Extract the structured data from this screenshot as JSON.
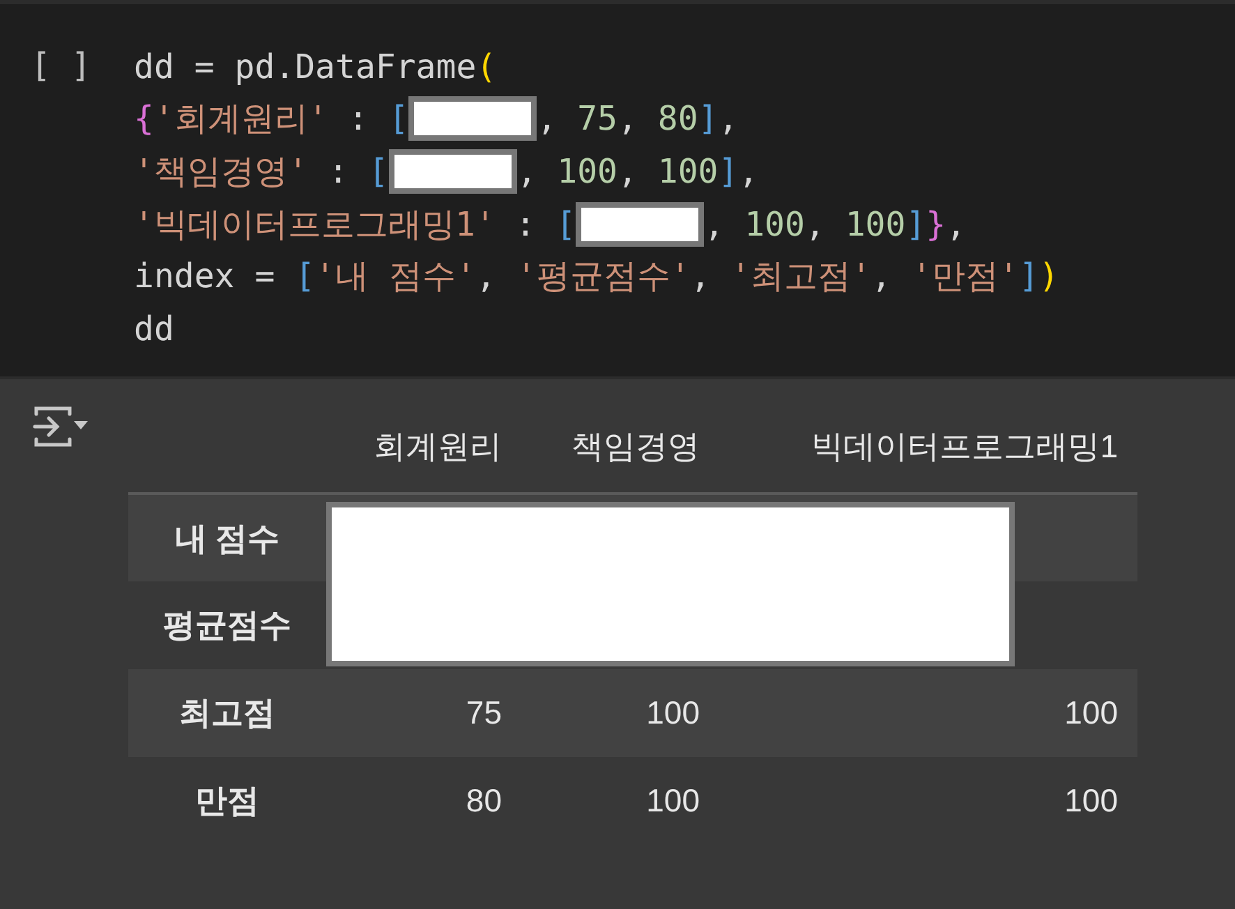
{
  "code_cell": {
    "run_marker": "[ ]",
    "lines": [
      [
        {
          "kind": "plain",
          "text": "dd = pd.DataFrame"
        },
        {
          "kind": "paren",
          "text": "("
        }
      ],
      [
        {
          "kind": "brace",
          "text": "{"
        },
        {
          "kind": "string",
          "text": "'회계원리'"
        },
        {
          "kind": "plain",
          "text": " : "
        },
        {
          "kind": "bracket",
          "text": "["
        },
        {
          "kind": "redacted"
        },
        {
          "kind": "plain",
          "text": ", "
        },
        {
          "kind": "number",
          "text": "75"
        },
        {
          "kind": "plain",
          "text": ", "
        },
        {
          "kind": "number",
          "text": "80"
        },
        {
          "kind": "bracket",
          "text": "]"
        },
        {
          "kind": "plain",
          "text": ","
        }
      ],
      [
        {
          "kind": "string",
          "text": "'책임경영'"
        },
        {
          "kind": "plain",
          "text": " : "
        },
        {
          "kind": "bracket",
          "text": "["
        },
        {
          "kind": "redacted"
        },
        {
          "kind": "plain",
          "text": ", "
        },
        {
          "kind": "number",
          "text": "100"
        },
        {
          "kind": "plain",
          "text": ", "
        },
        {
          "kind": "number",
          "text": "100"
        },
        {
          "kind": "bracket",
          "text": "]"
        },
        {
          "kind": "plain",
          "text": ","
        }
      ],
      [
        {
          "kind": "string",
          "text": "'빅데이터프로그래밍1'"
        },
        {
          "kind": "plain",
          "text": " : "
        },
        {
          "kind": "bracket",
          "text": "["
        },
        {
          "kind": "redacted"
        },
        {
          "kind": "plain",
          "text": ", "
        },
        {
          "kind": "number",
          "text": "100"
        },
        {
          "kind": "plain",
          "text": ", "
        },
        {
          "kind": "number",
          "text": "100"
        },
        {
          "kind": "bracket",
          "text": "]"
        },
        {
          "kind": "brace",
          "text": "}"
        },
        {
          "kind": "plain",
          "text": ","
        }
      ],
      [
        {
          "kind": "plain",
          "text": "index = "
        },
        {
          "kind": "bracket",
          "text": "["
        },
        {
          "kind": "string",
          "text": "'내 점수'"
        },
        {
          "kind": "plain",
          "text": ", "
        },
        {
          "kind": "string",
          "text": "'평균점수'"
        },
        {
          "kind": "plain",
          "text": ", "
        },
        {
          "kind": "string",
          "text": "'최고점'"
        },
        {
          "kind": "plain",
          "text": ", "
        },
        {
          "kind": "string",
          "text": "'만점'"
        },
        {
          "kind": "bracket",
          "text": "]"
        },
        {
          "kind": "paren",
          "text": ")"
        }
      ],
      [
        {
          "kind": "plain",
          "text": "dd"
        }
      ]
    ]
  },
  "output": {
    "table": {
      "columns": [
        "회계원리",
        "책임경영",
        "빅데이터프로그래밍1"
      ],
      "rows": [
        {
          "label": "내 점수",
          "redacted": true
        },
        {
          "label": "평균점수",
          "redacted": true
        },
        {
          "label": "최고점",
          "redacted": false,
          "cells": [
            "75",
            "100",
            "100"
          ]
        },
        {
          "label": "만점",
          "redacted": false,
          "cells": [
            "80",
            "100",
            "100"
          ]
        }
      ]
    }
  }
}
